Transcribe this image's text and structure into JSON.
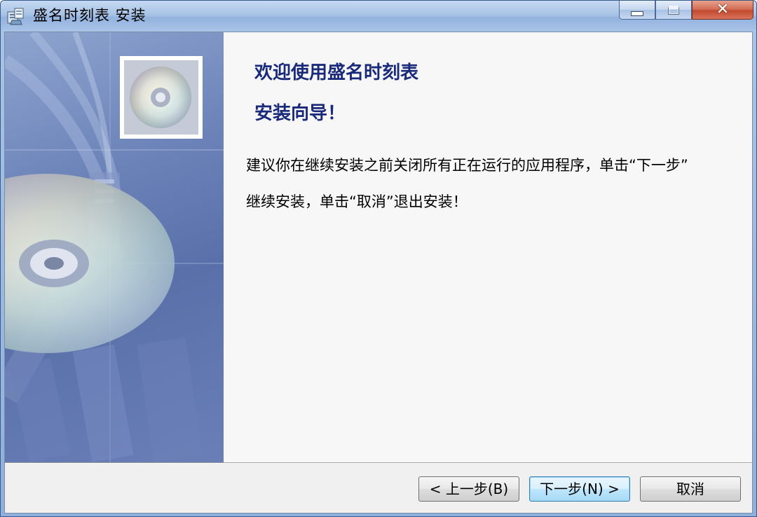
{
  "window": {
    "title": "盛名时刻表  安装"
  },
  "caption_buttons": {
    "minimize_icon": "minimize-icon",
    "maximize_icon": "maximize-icon",
    "close_icon": "close-icon"
  },
  "colors": {
    "heading": "#1a2a7a",
    "titlebar": "#a8c3e6",
    "close_button": "#c24a30",
    "default_button_border": "#3c7fb1"
  },
  "wizard": {
    "title_line1": "欢迎使用盛名时刻表",
    "title_line2": "安装向导！",
    "description_line1": "建议你在继续安装之前关闭所有正在运行的应用程序，单击“下一步”",
    "description_line2": "继续安装，单击“取消”退出安装！"
  },
  "buttons": {
    "back": "< 上一步(B)",
    "next": "下一步(N) >",
    "cancel": "取消"
  }
}
